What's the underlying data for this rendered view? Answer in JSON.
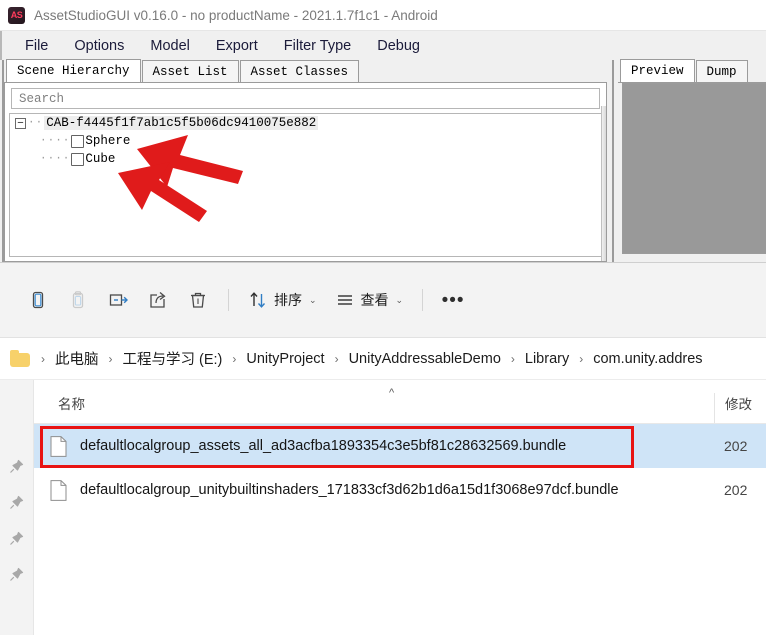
{
  "asset_studio": {
    "app_icon_text": "AS",
    "title": "AssetStudioGUI v0.16.0 - no productName - 2021.1.7f1c1 - Android",
    "menu": [
      {
        "label": "File"
      },
      {
        "label": "Options"
      },
      {
        "label": "Model"
      },
      {
        "label": "Export"
      },
      {
        "label": "Filter Type"
      },
      {
        "label": "Debug"
      }
    ],
    "tabs": [
      {
        "label": "Scene Hierarchy",
        "active": true
      },
      {
        "label": "Asset List",
        "active": false
      },
      {
        "label": "Asset Classes",
        "active": false
      }
    ],
    "search": {
      "placeholder": "Search",
      "value": ""
    },
    "tree": {
      "expander_glyph": "−",
      "root": {
        "label": "CAB-f4445f1f7ab1c5f5b06dc9410075e882"
      },
      "children": [
        {
          "label": "Sphere",
          "checked": false
        },
        {
          "label": "Cube",
          "checked": false
        }
      ]
    },
    "preview_tabs": [
      {
        "label": "Preview",
        "active": true
      },
      {
        "label": "Dump",
        "active": false
      }
    ],
    "preview_color": "#999999"
  },
  "annotations": {
    "arrow_color": "#e01b1b",
    "highlight_color": "#e81313",
    "arrows": [
      {
        "target": "Sphere"
      },
      {
        "target": "Cube"
      }
    ]
  },
  "explorer": {
    "toolbar": [
      {
        "name": "copy",
        "label": ""
      },
      {
        "name": "paste",
        "label": ""
      },
      {
        "name": "rename",
        "label": ""
      },
      {
        "name": "share",
        "label": ""
      },
      {
        "name": "delete",
        "label": ""
      },
      {
        "name": "sort",
        "label": "排序"
      },
      {
        "name": "view",
        "label": "查看"
      },
      {
        "name": "more",
        "label": ""
      }
    ],
    "sort_label": "排序",
    "view_label": "查看",
    "more_label": "•••",
    "breadcrumb": [
      "此电脑",
      "工程与学习 (E:)",
      "UnityProject",
      "UnityAddressableDemo",
      "Library",
      "com.unity.addres"
    ],
    "breadcrumb_separator": "›",
    "columns": {
      "name": "名称",
      "modified": "修改",
      "sort_indicator": "^"
    },
    "files": [
      {
        "name": "defaultlocalgroup_assets_all_ad3acfba1893354c3e5bf81c28632569.bundle",
        "modified": "202",
        "selected": true,
        "highlighted": true
      },
      {
        "name": "defaultlocalgroup_unitybuiltinshaders_171833cf3d62b1d6a15d1f3068e97dcf.bundle",
        "modified": "202",
        "selected": false,
        "highlighted": false
      }
    ],
    "rail_pins": 4
  }
}
